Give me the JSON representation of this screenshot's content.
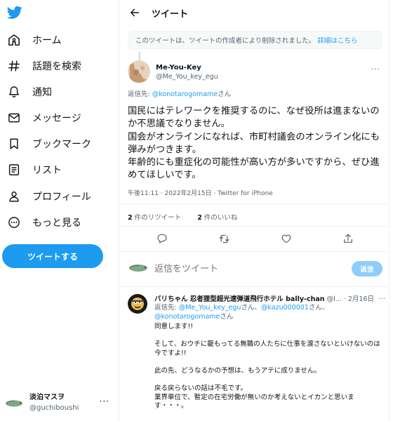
{
  "sidebar": {
    "nav": [
      {
        "label": "ホーム",
        "icon": "home-icon"
      },
      {
        "label": "話題を検索",
        "icon": "hashtag-icon"
      },
      {
        "label": "通知",
        "icon": "bell-icon"
      },
      {
        "label": "メッセージ",
        "icon": "mail-icon"
      },
      {
        "label": "ブックマーク",
        "icon": "bookmark-icon"
      },
      {
        "label": "リスト",
        "icon": "list-icon"
      },
      {
        "label": "プロフィール",
        "icon": "profile-icon"
      },
      {
        "label": "もっと見る",
        "icon": "more-circle-icon"
      }
    ],
    "tweet_button": "ツイートする",
    "account": {
      "display_name": "淡泊マスヲ",
      "handle": "@guchiboushi",
      "more": "···"
    }
  },
  "header": {
    "title": "ツイート"
  },
  "deleted_notice": {
    "text": "このツイートは、ツイートの作成者により削除されました。",
    "link": "詳細はこちら"
  },
  "tweet": {
    "display_name": "Me-You-Key",
    "handle": "@Me_You_key_egu",
    "more": "···",
    "reply_prefix": "返信先: ",
    "reply_mention": "@konotarogomame",
    "reply_suffix": "さん",
    "lines": [
      "国民にはテレワークを推奨するのに、なぜ役所は進まないのか不思議でなりません。",
      "国会がオンラインになれば、市町村議会のオンライン化にも弾みがつきます。",
      "年齢的にも重症化の可能性が高い方が多いですから、ぜひ進めてほしいです。"
    ],
    "meta": "午後11:11 · 2022年2月15日 · Twitter for iPhone",
    "retweets_count": "2",
    "retweets_label": " 件のリツイート",
    "likes_count": "2",
    "likes_label": " 件のいいね"
  },
  "compose": {
    "placeholder": "返信をツイート",
    "button": "返信"
  },
  "reply": {
    "display_name": "バリちゃん 忍者狸型超光速弾道飛行ホテル bally-chan",
    "handle": "@l...",
    "date": "· 2月16日",
    "more": "···",
    "reply_prefix": "返信先: ",
    "mention1": "@Me_You_key_egu",
    "sep1": "さん、",
    "mention2": "@kazu000001",
    "sep2": "さん、",
    "mention3": "@konotarogomame",
    "suffix": "さん",
    "paragraphs": [
      "同意します!!",
      "そして、おウチに籠もってる無職の人たちに仕事を渡さないといけないのは今ですよ!!",
      "此の先、どうなるかの予想は、もうアテに成りません。",
      "戻る戻らないの話は不毛です。\n業界単位で、暫定の在宅労働が無いのか考えないとイカンと思います・・・。"
    ]
  },
  "colors": {
    "accent": "#1d9bf0",
    "text": "#0f1419",
    "secondary": "#536471",
    "reply_button_disabled": "#8ecdf8"
  }
}
